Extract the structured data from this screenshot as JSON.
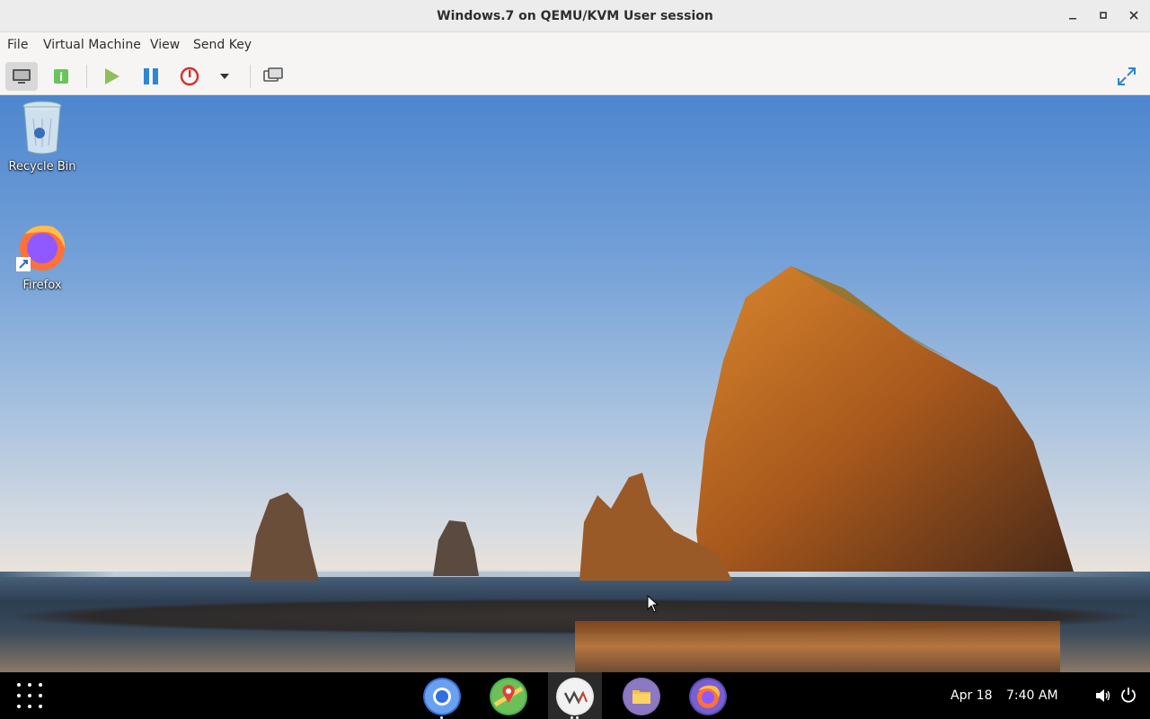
{
  "window": {
    "title": "Windows.7 on QEMU/KVM User session",
    "controls": [
      "minimize-icon",
      "maximize-icon",
      "close-icon"
    ]
  },
  "menu": {
    "file": "File",
    "virtual_machine": "Virtual Machine",
    "view": "View",
    "send_key": "Send Key"
  },
  "toolbar": {
    "icons": [
      "monitor-icon",
      "info-icon",
      "play-icon",
      "pause-icon",
      "power-icon",
      "dropdown-arrow-icon",
      "screenshot-icon",
      "fullscreen-icon"
    ]
  },
  "desktop": {
    "icons": [
      {
        "label": "Recycle Bin",
        "icon": "recycle-bin-icon"
      },
      {
        "label": "Firefox",
        "icon": "firefox-icon"
      }
    ]
  },
  "taskbar": {
    "date": "Apr 18",
    "time": "7:40 AM",
    "apps": [
      "chromium-icon",
      "maps-icon",
      "virt-manager-icon",
      "files-icon",
      "firefox-icon"
    ],
    "colors": {
      "accent_blue": "#3584e4",
      "bg": "#000000"
    }
  }
}
